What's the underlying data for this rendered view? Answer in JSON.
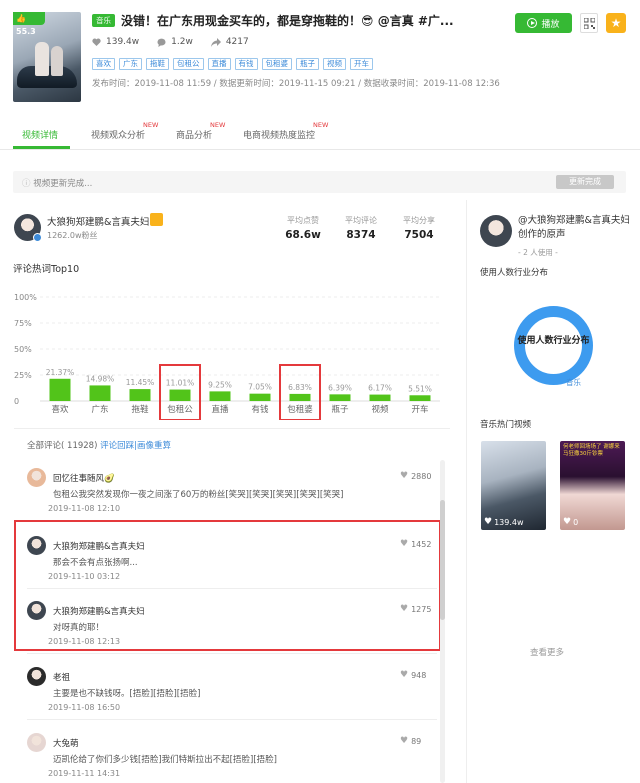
{
  "header": {
    "score": "55.3",
    "category_tag": "音乐",
    "title": "没错！在广东用现金买车的，都是穿拖鞋的！😎 @言真 #广...",
    "stats": {
      "likes": "139.4w",
      "comments": "1.2w",
      "shares": "4217"
    },
    "keywords": [
      "喜欢",
      "广东",
      "拖鞋",
      "包租公",
      "直播",
      "有钱",
      "包租婆",
      "瓶子",
      "视频",
      "开车"
    ],
    "times": "发布时间：2019-11-08 11:59 / 数据更新时间：2019-11-15 09:21 / 数据收录时间：2019-11-08 12:36",
    "play_label": "播放"
  },
  "tabs": [
    {
      "label": "视频详情",
      "new": ""
    },
    {
      "label": "视频观众分析",
      "new": "NEW"
    },
    {
      "label": "商品分析",
      "new": "NEW"
    },
    {
      "label": "电商视频热度监控",
      "new": "NEW"
    }
  ],
  "update": {
    "text": "视频更新完成...",
    "button": "更新完成"
  },
  "author": {
    "name": "大狼狗郑建鹏&言真夫妇",
    "fans": "1262.0w粉丝",
    "metrics": [
      {
        "label": "平均点赞",
        "value": "68.6w"
      },
      {
        "label": "平均评论",
        "value": "8374"
      },
      {
        "label": "平均分享",
        "value": "7504"
      }
    ]
  },
  "chart_title": "评论热词Top10",
  "chart_data": {
    "type": "bar",
    "categories": [
      "喜欢",
      "广东",
      "拖鞋",
      "包租公",
      "直播",
      "有钱",
      "包租婆",
      "瓶子",
      "视频",
      "开车"
    ],
    "values": [
      21.37,
      14.98,
      11.45,
      11.01,
      9.25,
      7.05,
      6.83,
      6.39,
      6.17,
      5.51
    ],
    "value_labels": [
      "21.37%",
      "14.98%",
      "11.45%",
      "11.01%",
      "9.25%",
      "7.05%",
      "6.83%",
      "6.39%",
      "6.17%",
      "5.51%"
    ],
    "y_ticks": [
      "100%",
      "75%",
      "50%",
      "25%",
      "0"
    ],
    "ylim": [
      0,
      100
    ],
    "color": "#52c41a",
    "highlighted": [
      "包租公",
      "包租婆"
    ]
  },
  "comments_header": {
    "label": "全部评论",
    "count": "( 11928)",
    "link": "评论回踩|画像重算"
  },
  "comments": [
    {
      "name": "回忆往事随风🥑",
      "text": "包租公我突然发现你一夜之间涨了60万的粉丝[笑哭][笑哭][笑哭][笑哭][笑哭]",
      "time": "2019-11-08 12:10",
      "likes": "2880"
    },
    {
      "name": "大狼狗郑建鹏&言真夫妇",
      "text": "那会不会有点张扬啊...",
      "time": "2019-11-10 03:12",
      "likes": "1452"
    },
    {
      "name": "大狼狗郑建鹏&言真夫妇",
      "text": "对呀真的耶！",
      "time": "2019-11-08 12:13",
      "likes": "1275"
    },
    {
      "name": "老祖",
      "text": "主要是也不缺钱呀。[捂脸][捂脸][捂脸]",
      "time": "2019-11-08 16:50",
      "likes": "948"
    },
    {
      "name": "大兔萌",
      "text": "迈凯伦给了你们多少钱[捂脸]我们特斯拉出不起[捂脸][捂脸]",
      "time": "2019-11-11 14:31",
      "likes": "89"
    }
  ],
  "sidebar": {
    "music_name": "@大狼狗郑建鹏&言真夫妇创作的原声",
    "used": "- 2 人使用 -",
    "dist_title": "使用人数行业分布",
    "donut_label": "使用人数行业分布",
    "donut_tag": "音乐",
    "hot_title": "音乐热门视频",
    "videos": [
      {
        "stat": "139.4w",
        "caption": ""
      },
      {
        "stat": "0",
        "caption": "何老师回场场了 谢娜来马狂撒30斤钞票"
      }
    ],
    "more": "查看更多"
  }
}
